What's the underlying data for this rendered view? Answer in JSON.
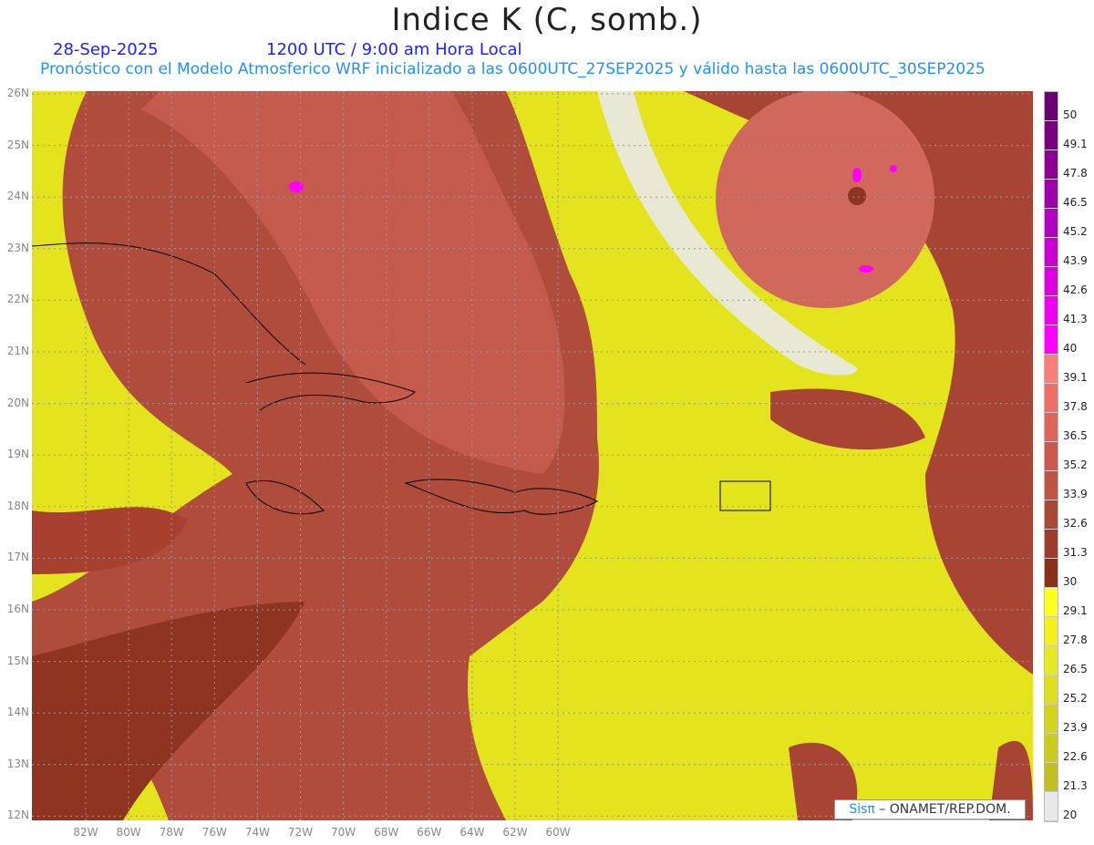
{
  "header": {
    "title": "Indice K (C, somb.)",
    "date": "28-Sep-2025",
    "time": "1200 UTC / 9:00 am Hora Local",
    "subtitle": "Pronóstico con el Modelo Atmosferico WRF inicializado a las 0600UTC_27SEP2025 y válido hasta las  0600UTC_30SEP2025"
  },
  "lat_labels": [
    "26N",
    "25N",
    "24N",
    "23N",
    "22N",
    "21N",
    "20N",
    "19N",
    "18N",
    "17N",
    "16N",
    "15N",
    "14N",
    "13N",
    "12N"
  ],
  "lon_labels": [
    "82W",
    "80W",
    "78W",
    "76W",
    "74W",
    "72W",
    "70W",
    "68W",
    "66W",
    "64W",
    "62W",
    "60W"
  ],
  "colorbar": {
    "labels": [
      "50",
      "49.1",
      "47.8",
      "46.5",
      "45.2",
      "43.9",
      "42.6",
      "41.3",
      "40",
      "39.1",
      "37.8",
      "36.5",
      "35.2",
      "33.9",
      "32.6",
      "31.3",
      "30",
      "29.1",
      "27.8",
      "26.5",
      "25.2",
      "23.9",
      "22.6",
      "21.3",
      "20"
    ],
    "colors": [
      "#6a0070",
      "#780080",
      "#8a0090",
      "#9c00a8",
      "#b000c0",
      "#c800d0",
      "#dc00dc",
      "#ee00ee",
      "#ff00ff",
      "#f88078",
      "#ec7068",
      "#dc6458",
      "#cc5a4c",
      "#be5444",
      "#aa4838",
      "#9c3c2c",
      "#8a3018",
      "#ffff20",
      "#f4f020",
      "#e8e820",
      "#dede1e",
      "#d4d41c",
      "#cccc1e",
      "#c0c020",
      "#e8e8e8"
    ]
  },
  "credit": {
    "brand": "Sisπ",
    "org": " – ONAMET/REP.DOM."
  }
}
